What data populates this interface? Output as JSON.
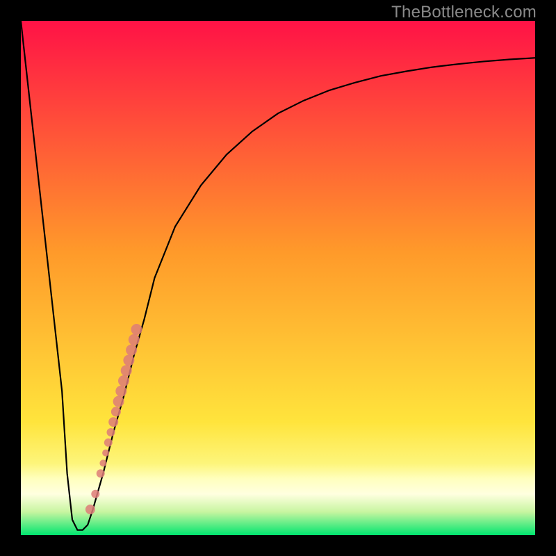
{
  "watermark": "TheBottleneck.com",
  "colors": {
    "frame": "#000000",
    "curve": "#000000",
    "marker_fill": "#dd7d78",
    "marker_stroke": "#dd7d78",
    "gradient_top": "#ff1246",
    "gradient_mid1": "#ff7f2a",
    "gradient_mid2": "#ffe43c",
    "gradient_band": "#ffffbd",
    "gradient_bottom": "#00e56f"
  },
  "chart_data": {
    "type": "line",
    "title": "",
    "xlabel": "",
    "ylabel": "",
    "xlim": [
      0,
      100
    ],
    "ylim": [
      0,
      100
    ],
    "series": [
      {
        "name": "bottleneck-curve",
        "x": [
          0,
          2,
          4,
          6,
          8,
          9,
          10,
          11,
          12,
          13,
          14,
          16,
          18,
          20,
          22,
          24,
          26,
          28,
          30,
          35,
          40,
          45,
          50,
          55,
          60,
          65,
          70,
          75,
          80,
          85,
          90,
          95,
          100
        ],
        "y": [
          100,
          82,
          64,
          46,
          28,
          12,
          3,
          1,
          1,
          2,
          5,
          12,
          20,
          27,
          35,
          42,
          50,
          55,
          60,
          68,
          74,
          78.5,
          82,
          84.5,
          86.5,
          88,
          89.3,
          90.2,
          91,
          91.6,
          92.1,
          92.5,
          92.8
        ]
      }
    ],
    "markers": [
      {
        "x": 13.5,
        "y": 5,
        "r": 7
      },
      {
        "x": 14.5,
        "y": 8,
        "r": 6
      },
      {
        "x": 15.5,
        "y": 12,
        "r": 6
      },
      {
        "x": 16.0,
        "y": 14,
        "r": 5
      },
      {
        "x": 16.5,
        "y": 16,
        "r": 5
      },
      {
        "x": 17.0,
        "y": 18,
        "r": 6
      },
      {
        "x": 17.5,
        "y": 20,
        "r": 6
      },
      {
        "x": 18.0,
        "y": 22,
        "r": 7
      },
      {
        "x": 18.5,
        "y": 24,
        "r": 7
      },
      {
        "x": 19.0,
        "y": 26,
        "r": 8
      },
      {
        "x": 19.5,
        "y": 28,
        "r": 8
      },
      {
        "x": 20.0,
        "y": 30,
        "r": 8
      },
      {
        "x": 20.5,
        "y": 32,
        "r": 8
      },
      {
        "x": 21.0,
        "y": 34,
        "r": 8
      },
      {
        "x": 21.5,
        "y": 36,
        "r": 8
      },
      {
        "x": 22.0,
        "y": 38,
        "r": 8
      },
      {
        "x": 22.5,
        "y": 40,
        "r": 8
      }
    ]
  }
}
